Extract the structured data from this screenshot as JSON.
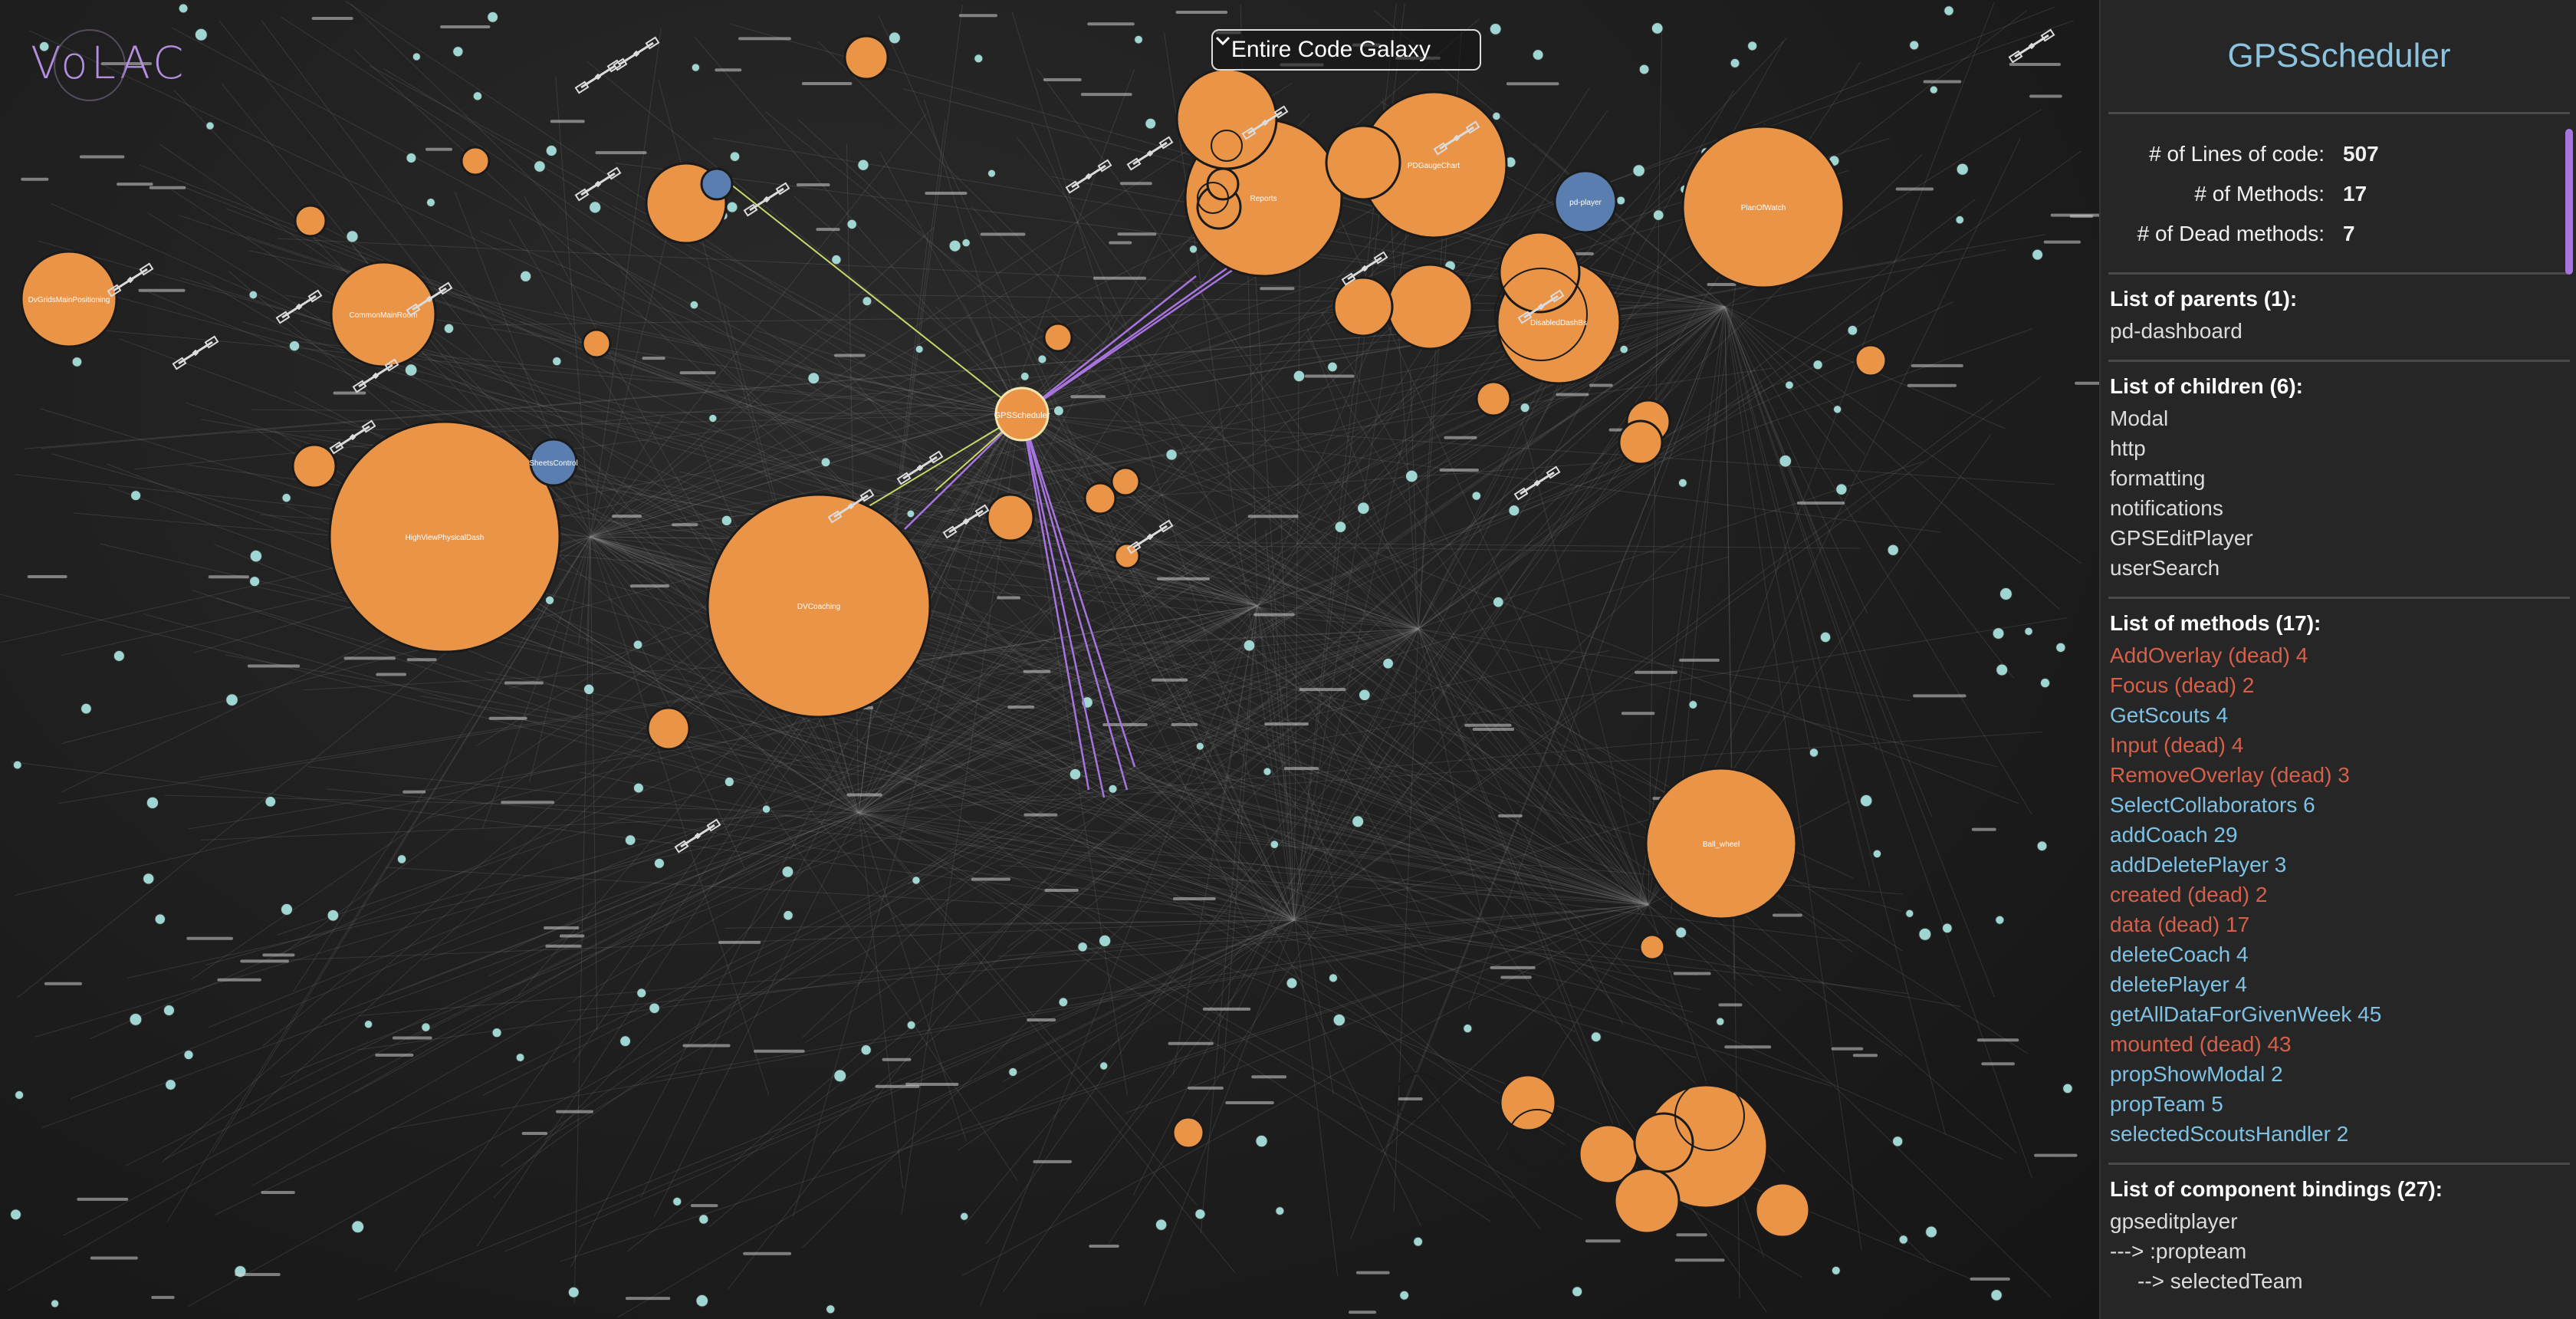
{
  "app": {
    "logo_text": "VoLAC"
  },
  "scope_selector": {
    "selected": "Entire Code Galaxy"
  },
  "galaxy": {
    "central_node": "GPSScheduler",
    "large_nodes": [
      {
        "label": "HighViewPhysicalDash",
        "color": "#e99447"
      },
      {
        "label": "DVCoaching",
        "color": "#e99447"
      },
      {
        "label": "PlanOfWatch",
        "color": "#e99447"
      },
      {
        "label": "Ball_wheel",
        "color": "#e99447"
      },
      {
        "label": "Reports",
        "color": "#e99447"
      },
      {
        "label": "PDGaugeChart",
        "color": "#e99447"
      },
      {
        "label": "DisabledDashBs",
        "color": "#e99447"
      },
      {
        "label": "DvGridsMainPositioning",
        "color": "#e99447"
      },
      {
        "label": "CommonMainRoom",
        "color": "#e99447"
      },
      {
        "label": "pd-player",
        "color": "#5b7eb0"
      },
      {
        "label": "SheetsControl",
        "color": "#5b7eb0"
      }
    ]
  },
  "sidebar": {
    "title": "GPSScheduler",
    "metrics": [
      {
        "label": "# of Lines of code:",
        "value": "507"
      },
      {
        "label": "# of Methods:",
        "value": "17"
      },
      {
        "label": "# of Dead methods:",
        "value": "7"
      }
    ],
    "parents": {
      "header": "List of parents (1):",
      "items": [
        "pd-dashboard"
      ]
    },
    "children": {
      "header": "List of children (6):",
      "items": [
        "Modal",
        "http",
        "formatting",
        "notifications",
        "GPSEditPlayer",
        "userSearch"
      ]
    },
    "methods": {
      "header": "List of methods (17):",
      "items": [
        {
          "text": "AddOverlay (dead) 4",
          "dead": true
        },
        {
          "text": "Focus (dead) 2",
          "dead": true
        },
        {
          "text": "GetScouts 4",
          "dead": false
        },
        {
          "text": "Input (dead) 4",
          "dead": true
        },
        {
          "text": "RemoveOverlay (dead) 3",
          "dead": true
        },
        {
          "text": "SelectCollaborators 6",
          "dead": false
        },
        {
          "text": "addCoach 29",
          "dead": false
        },
        {
          "text": "addDeletePlayer 3",
          "dead": false
        },
        {
          "text": "created (dead) 2",
          "dead": true
        },
        {
          "text": "data (dead) 17",
          "dead": true
        },
        {
          "text": "deleteCoach 4",
          "dead": false
        },
        {
          "text": "deletePlayer 4",
          "dead": false
        },
        {
          "text": "getAllDataForGivenWeek 45",
          "dead": false
        },
        {
          "text": "mounted (dead) 43",
          "dead": true
        },
        {
          "text": "propShowModal 2",
          "dead": false
        },
        {
          "text": "propTeam 5",
          "dead": false
        },
        {
          "text": "selectedScoutsHandler 2",
          "dead": false
        }
      ]
    },
    "bindings": {
      "header": "List of component bindings (27):",
      "items": [
        "gpseditplayer",
        "---> :propteam",
        "--> selectedTeam"
      ]
    }
  }
}
